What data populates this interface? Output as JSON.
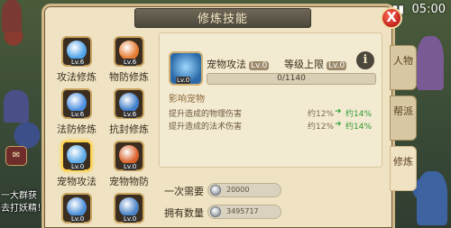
{
  "status_bar": {
    "time": "05:00",
    "signal_icon": "signal-icon",
    "wifi_icon": "wifi-icon"
  },
  "panel": {
    "title": "修炼技能",
    "close_label": "X"
  },
  "skills": [
    {
      "name": "攻法修炼",
      "level": "Lv.6",
      "color": "#4fa3e8"
    },
    {
      "name": "物防修炼",
      "level": "Lv.6",
      "color": "#e47a30"
    },
    {
      "name": "法防修炼",
      "level": "Lv.6",
      "color": "#4d8fe0"
    },
    {
      "name": "抗封修炼",
      "level": "Lv.6",
      "color": "#3f7ec8"
    },
    {
      "name": "宠物攻法",
      "level": "Lv.0",
      "color": "#5aa8e6",
      "selected": true
    },
    {
      "name": "宠物物防",
      "level": "Lv.0",
      "color": "#d8612a"
    },
    {
      "name": "",
      "level": "Lv.0",
      "color": "#4b8ed8"
    },
    {
      "name": "",
      "level": "Lv.0",
      "color": "#4a82c6"
    }
  ],
  "detail": {
    "skill_name": "宠物攻法",
    "skill_level": "Lv.0",
    "max_level_label": "等级上限",
    "max_level_value": "Lv.0",
    "info_label": "i",
    "xp_text": "0/1140",
    "xp_fraction": 0,
    "effects_title": "影响宠物",
    "effects": [
      {
        "label": "提升造成的物理伤害",
        "current": "约12%",
        "next": "约14%"
      },
      {
        "label": "提升造成的法术伤害",
        "current": "约12%",
        "next": "约14%"
      }
    ]
  },
  "cost": {
    "once_label": "一次需要",
    "once_value": "20000",
    "owned_label": "拥有数量",
    "owned_value": "3495717"
  },
  "side_tabs": [
    {
      "label": "人物",
      "active": false
    },
    {
      "label": "帮派",
      "active": false
    },
    {
      "label": "修炼",
      "active": true
    }
  ],
  "chat_lines": [
    "一大群获",
    "去打妖精！"
  ],
  "colors": {
    "panel_bg": "#efe3c4",
    "title_bg": "#4c473c",
    "close_red": "#c2231b",
    "xp_fill": "#e58b2b",
    "green_up": "#2f9a2f"
  }
}
